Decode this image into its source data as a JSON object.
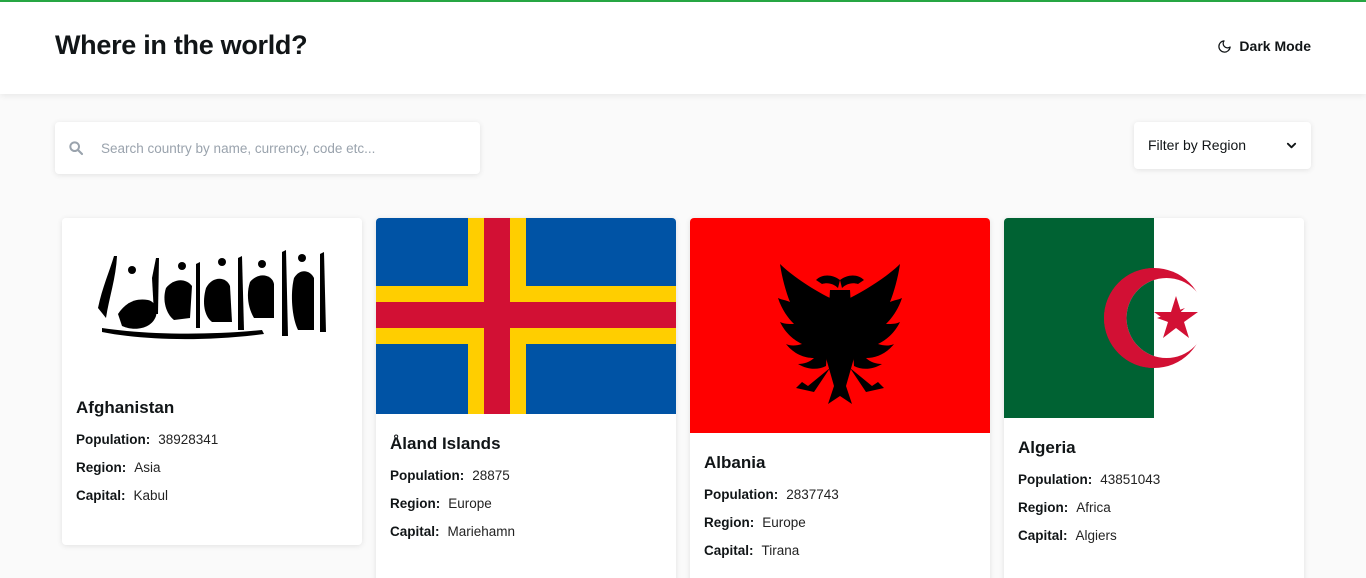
{
  "header": {
    "title": "Where in the world?",
    "dark_mode_label": "Dark Mode",
    "moon_icon": "moon-icon"
  },
  "search": {
    "placeholder": "Search country by name, currency, code etc...",
    "value": "",
    "icon": "search-icon"
  },
  "filter": {
    "label": "Filter by Region",
    "icon": "chevron-down-icon"
  },
  "labels": {
    "population": "Population:",
    "region": "Region:",
    "capital": "Capital:"
  },
  "countries": [
    {
      "name": "Afghanistan",
      "population": "38928341",
      "region": "Asia",
      "capital": "Kabul",
      "flag": "afghanistan-flag"
    },
    {
      "name": "Åland Islands",
      "population": "28875",
      "region": "Europe",
      "capital": "Mariehamn",
      "flag": "aland-flag"
    },
    {
      "name": "Albania",
      "population": "2837743",
      "region": "Europe",
      "capital": "Tirana",
      "flag": "albania-flag"
    },
    {
      "name": "Algeria",
      "population": "43851043",
      "region": "Africa",
      "capital": "Algiers",
      "flag": "algeria-flag"
    }
  ],
  "colors": {
    "accent_topline": "#27a844",
    "background": "#fafafa",
    "card": "#ffffff",
    "text": "#111517"
  }
}
